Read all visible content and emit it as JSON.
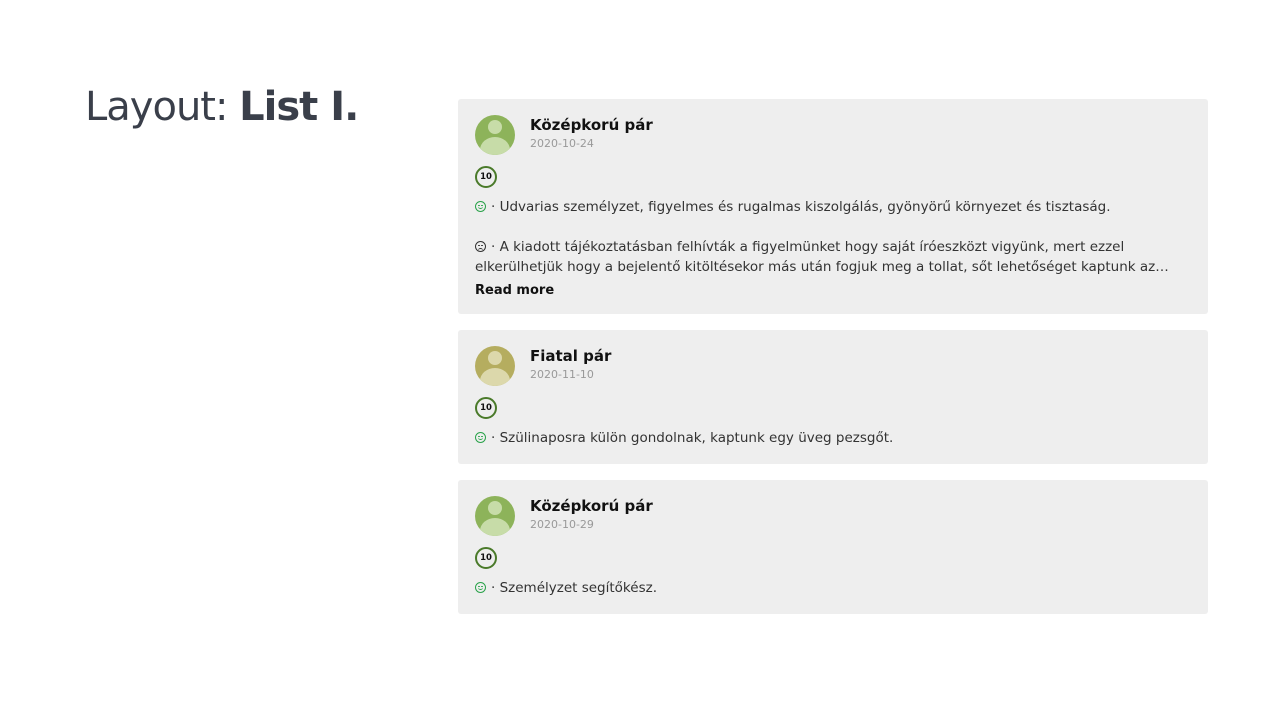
{
  "page": {
    "title_prefix": "Layout: ",
    "title_strong": "List I."
  },
  "reviews": [
    {
      "name": "Középkorú pár",
      "date": "2020-10-24",
      "score": "10",
      "avatar_color": "#8db35a",
      "avatar_head": "#c7dca8",
      "avatar_body": "#c7dca8",
      "positive": "· Udvarias személyzet, figyelmes és rugalmas kiszolgálás, gyönyörű környezet és tisztaság.",
      "negative": "· A kiadott tájékoztatásban felhívták a figyelmünket hogy saját íróeszközt vigyünk, mert ezzel elkerülhetjük hogy a bejelentő kitöltésekor más után fogjuk meg a tollat, sőt lehetőséget kaptunk az online bejelentkezésre is.",
      "read_more": "Read more"
    },
    {
      "name": "Fiatal pár",
      "date": "2020-11-10",
      "score": "10",
      "avatar_color": "#b5ad5f",
      "avatar_head": "#dcd8ab",
      "avatar_body": "#dcd8ab",
      "positive": "· Szülinaposra külön gondolnak, kaptunk egy üveg pezsgőt."
    },
    {
      "name": "Középkorú pár",
      "date": "2020-10-29",
      "score": "10",
      "avatar_color": "#8db35a",
      "avatar_head": "#c7dca8",
      "avatar_body": "#c7dca8",
      "positive": "· Személyzet segítőkész."
    }
  ],
  "colors": {
    "card_bg": "#eeeeee",
    "badge_border": "#4a7a2a",
    "positive_icon": "#2aa24a"
  },
  "icons": {
    "positive": "smile-icon",
    "negative": "frown-icon",
    "avatar": "user-avatar-icon"
  }
}
